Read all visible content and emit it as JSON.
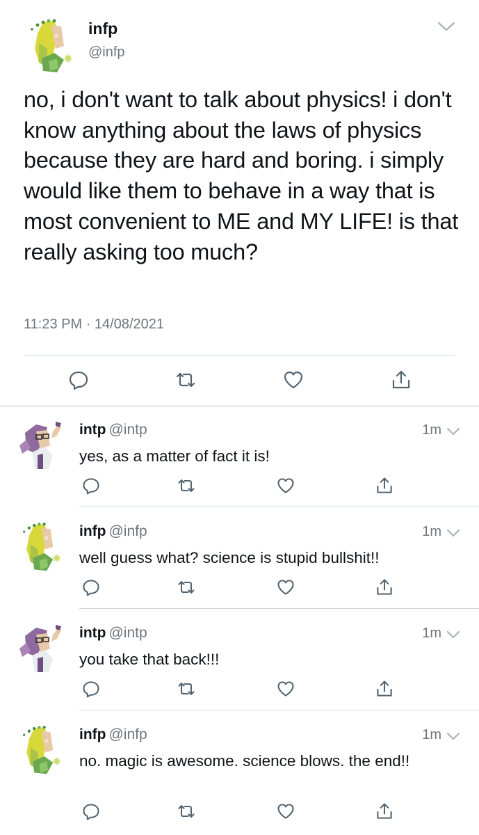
{
  "main_tweet": {
    "name": "infp",
    "handle": "@infp",
    "text": "no, i don't want to talk about physics! i don't know anything about the laws of physics because they are hard and boring. i simply would like them to behave in a way that is most convenient to ME and MY LIFE! is that really asking too much?",
    "time": "11:23 PM",
    "separator": "·",
    "date": "14/08/2021",
    "avatar": "infp-elf-avatar",
    "menu_icon": "chevron-down-icon",
    "actions": [
      "reply-icon",
      "retweet-icon",
      "like-icon",
      "share-icon"
    ]
  },
  "replies": [
    {
      "name": "intp",
      "handle": "@intp",
      "time": "1m",
      "text": "yes, as a matter of fact it is!",
      "avatar": "intp-scientist-avatar"
    },
    {
      "name": "infp",
      "handle": "@infp",
      "time": "1m",
      "text": "well guess what? science is stupid bullshit!!",
      "avatar": "infp-elf-avatar"
    },
    {
      "name": "intp",
      "handle": "@intp",
      "time": "1m",
      "text": "you take that back!!!",
      "avatar": "intp-scientist-avatar"
    },
    {
      "name": "infp",
      "handle": "@infp",
      "time": "1m",
      "text": "no. magic is awesome. science blows. the end!!",
      "avatar": "infp-elf-avatar"
    }
  ],
  "colors": {
    "text": "#0f1419",
    "secondary": "#6e767d",
    "icon": "#536471",
    "divider": "#cfd9de",
    "infp_green": "#88b04b",
    "infp_yellow": "#d8d83a",
    "intp_purple": "#8e6a9e"
  }
}
